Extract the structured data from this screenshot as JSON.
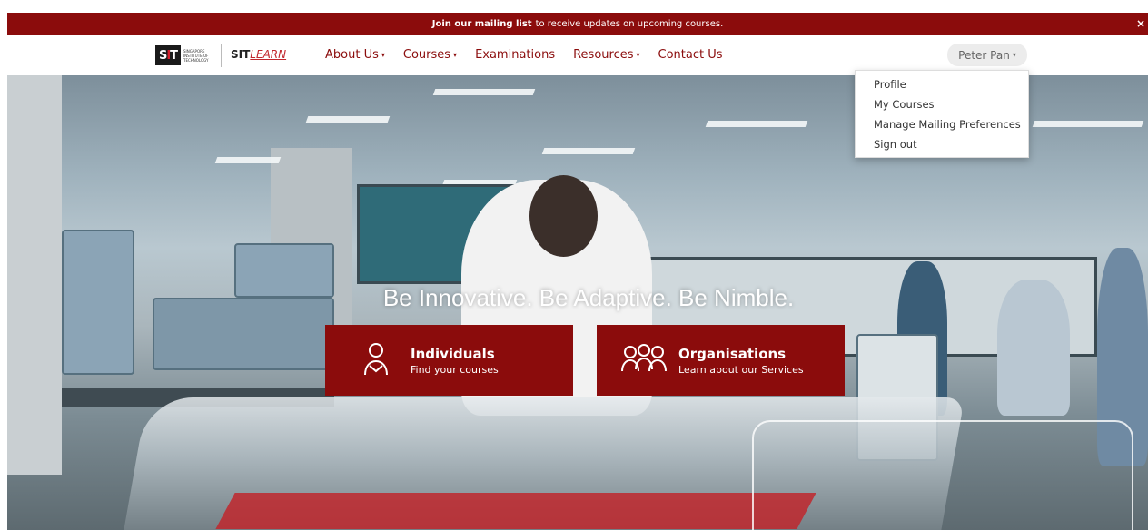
{
  "announcement": {
    "link_text": "Join our mailing list",
    "rest_text": "to receive updates on upcoming courses.",
    "close": "×"
  },
  "nav": {
    "brand": {
      "logo_text": "SIT",
      "logo_small": "SINGAPORE INSTITUTE OF TECHNOLOGY",
      "learn_prefix": "SIT",
      "learn_suffix": "LEARN"
    },
    "items": [
      {
        "label": "About Us",
        "dropdown": true
      },
      {
        "label": "Courses",
        "dropdown": true
      },
      {
        "label": "Examinations",
        "dropdown": false
      },
      {
        "label": "Resources",
        "dropdown": true
      },
      {
        "label": "Contact Us",
        "dropdown": false
      }
    ],
    "user": {
      "name": "Peter Pan"
    },
    "caret": "▾"
  },
  "user_menu": {
    "options": [
      "Profile",
      "My Courses",
      "Manage Mailing Preferences",
      "Sign out"
    ]
  },
  "hero": {
    "tagline": "Be Innovative. Be Adaptive. Be Nimble.",
    "cta_individuals": {
      "title": "Individuals",
      "subtitle": "Find your courses",
      "icon": "person-icon"
    },
    "cta_organisations": {
      "title": "Organisations",
      "subtitle": "Learn about our Services",
      "icon": "group-icon"
    }
  },
  "colors": {
    "brand": "#8b0c0c",
    "accent": "#c1272d"
  }
}
